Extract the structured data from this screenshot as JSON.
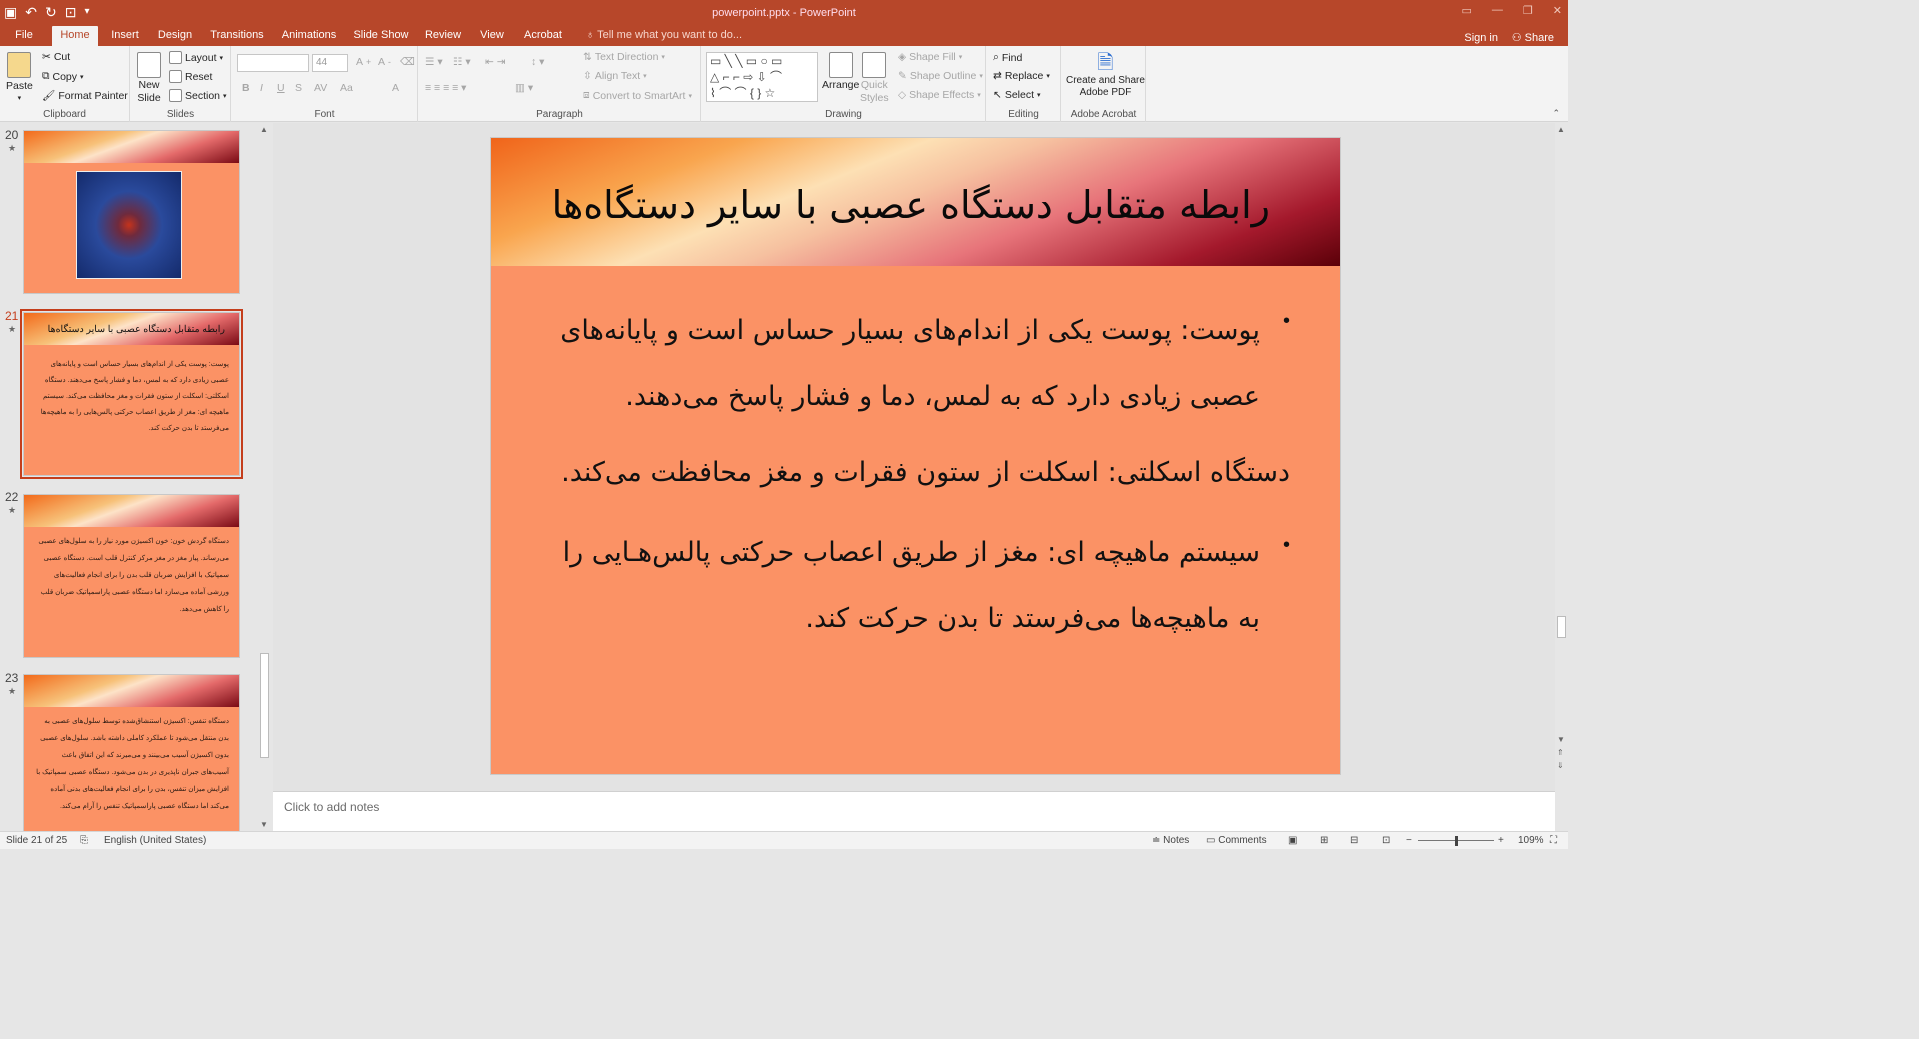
{
  "window": {
    "title": "powerpoint.pptx - PowerPoint"
  },
  "tabs": [
    {
      "label": "File"
    },
    {
      "label": "Home"
    },
    {
      "label": "Insert"
    },
    {
      "label": "Design"
    },
    {
      "label": "Transitions"
    },
    {
      "label": "Animations"
    },
    {
      "label": "Slide Show"
    },
    {
      "label": "Review"
    },
    {
      "label": "View"
    },
    {
      "label": "Acrobat"
    }
  ],
  "tell_me": "Tell me what you want to do...",
  "account": {
    "sign_in": "Sign in",
    "share": "Share"
  },
  "ribbon": {
    "clipboard": {
      "paste": "Paste",
      "cut": "Cut",
      "copy": "Copy",
      "format_painter": "Format Painter",
      "label": "Clipboard"
    },
    "slides": {
      "new_slide": "New",
      "new_slide2": "Slide",
      "layout": "Layout",
      "reset": "Reset",
      "section": "Section",
      "label": "Slides"
    },
    "font": {
      "size": "44",
      "label": "Font",
      "bold": "B",
      "italic": "I",
      "underline": "U",
      "strike": "S",
      "spacing": "AV",
      "case": "Aa",
      "color": "A"
    },
    "paragraph": {
      "text_direction": "Text Direction",
      "align_text": "Align Text",
      "smartart": "Convert to SmartArt",
      "label": "Paragraph"
    },
    "drawing": {
      "arrange": "Arrange",
      "quick_styles": "Quick",
      "quick_styles2": "Styles",
      "shape_fill": "Shape Fill",
      "shape_outline": "Shape Outline",
      "shape_effects": "Shape Effects",
      "label": "Drawing"
    },
    "editing": {
      "find": "Find",
      "replace": "Replace",
      "select": "Select",
      "label": "Editing"
    },
    "acrobat": {
      "create_share": "Create and Share",
      "adobe_pdf": "Adobe PDF",
      "label": "Adobe Acrobat"
    }
  },
  "thumbnails": [
    {
      "num": "20",
      "title": "",
      "text": ""
    },
    {
      "num": "21",
      "title": "رابطه متقابل دستگاه عصبی با سایر دستگاه‌ها",
      "text": "پوست: پوست یکی از اندام‌های بسیار حساس است و پایانه‌های عصبی زیادی دارد که به لمس، دما و فشار پاسخ می‌دهند. دستگاه اسکلتی: اسکلت از ستون فقرات و مغز محافظت می‌کند. سیستم ماهیچه ای: مغز از طریق اعصاب حرکتی پالس‌هایی را به ماهیچه‌ها می‌فرستد تا بدن حرکت کند."
    },
    {
      "num": "22",
      "title": "",
      "text": "دستگاه گردش خون: خون اکسیژن مورد نیاز را به سلول‌های عصبی می‌رساند. پیاز مغز در مغز مرکز کنترل قلب است. دستگاه عصبی سمپاتیک با افزایش ضربان قلب بدن را برای انجام فعالیت‌های ورزشی آماده می‌سازد اما دستگاه عصبی پاراسمپاتیک ضربان قلب را کاهش می‌دهد."
    },
    {
      "num": "23",
      "title": "",
      "text": "دستگاه تنفس: اکسیژن استنشاق‌شده توسط سلول‌های عصبی به بدن منتقل می‌شود تا عملکرد کاملی داشته باشد. سلول‌های عصبی بدون اکسیژن آسیب می‌بینند و می‌میرند که این اتفاق باعث آسیب‌های جبران ناپذیری در بدن می‌شود. دستگاه عصبی سمپاتیک با افزایش میزان تنفس، بدن را برای انجام فعالیت‌های بدنی آماده می‌کند اما دستگاه عصبی پاراسمپاتیک تنفس را آرام می‌کند."
    }
  ],
  "slide": {
    "title": "رابطه متقابل دستگاه عصبی با سایر دستگاه‌ها",
    "p1a": "پوست: پوست یکی از اندام‌های بسیار حساس است و پایانه‌های",
    "p1b": "عصبی زیادی دارد که به لمس، دما و فشار پاسخ می‌دهند.",
    "p2": "دستگاه اسکلتی: اسکلت از ستون فقرات و مغز محافظت می‌کند.",
    "p3a": "سیستم ماهیچه ای: مغز از طریق اعصاب حرکتی پالس‌هـایی را",
    "p3b": "به ماهیچه‌ها می‌فرستد تا بدن حرکت کند.",
    "bullet": "•"
  },
  "notes_placeholder": "Click to add notes",
  "status": {
    "slide": "Slide 21 of 25",
    "language": "English (United States)",
    "notes": "Notes",
    "comments": "Comments",
    "zoom": "109%"
  },
  "colors": {
    "accent": "#b7472a",
    "slide_bg": "#fb9265"
  }
}
